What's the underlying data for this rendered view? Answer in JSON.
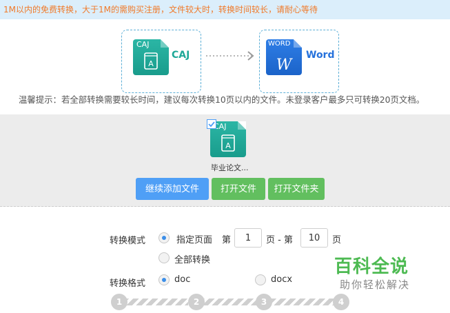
{
  "notice": "1M以内的免费转换，大于1M的需购买注册，文件较大时，转换时间较长，请耐心等待",
  "conversion": {
    "from_tag": "CAJ",
    "from_label": "CAJ",
    "to_tag": "WORD",
    "to_label": "Word",
    "word_glyph": "W",
    "caj_glyph": "A"
  },
  "hint": "温馨提示：若全部转换需要较长时间，建议每次转换10页以内的文件。未登录客户最多只可转换20页文档。",
  "file": {
    "tag": "CAJ",
    "name": "毕业论文..."
  },
  "buttons": {
    "add_more": "继续添加文件",
    "open_file": "打开文件",
    "open_folder": "打开文件夹"
  },
  "mode": {
    "label": "转换模式",
    "option_range": "指定页面",
    "page_prefix": "第",
    "page_from": "1",
    "page_mid": "页 - 第",
    "page_to": "10",
    "page_suffix": "页",
    "option_all": "全部转换",
    "selected": "range"
  },
  "format": {
    "label": "转换格式",
    "option_doc": "doc",
    "option_docx": "docx",
    "selected": "doc"
  },
  "steps": [
    "1",
    "2",
    "3",
    "4"
  ],
  "watermark": {
    "main": "百科全说",
    "sub": "助你轻松解决"
  },
  "colors": {
    "caj": "#1fa898",
    "word": "#2672dc",
    "notice_text": "#f07a2a",
    "button_blue": "#4f9ff6",
    "button_green": "#62bf5f",
    "watermark": "#4dba52"
  }
}
